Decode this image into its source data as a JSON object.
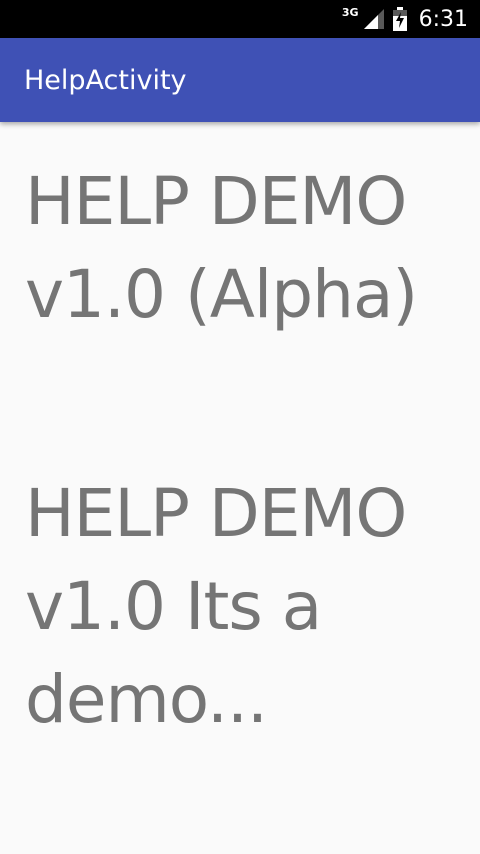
{
  "status_bar": {
    "network_type": "3G",
    "time": "6:31",
    "icons": [
      "signal-icon",
      "battery-icon"
    ]
  },
  "app_bar": {
    "title": "HelpActivity",
    "color": "#3f51b5"
  },
  "content": {
    "title": "HELP DEMO\nv1.0 (Alpha)",
    "description": "HELP DEMO\nv1.0 Its a\ndemo...",
    "text_color": "#757575"
  }
}
